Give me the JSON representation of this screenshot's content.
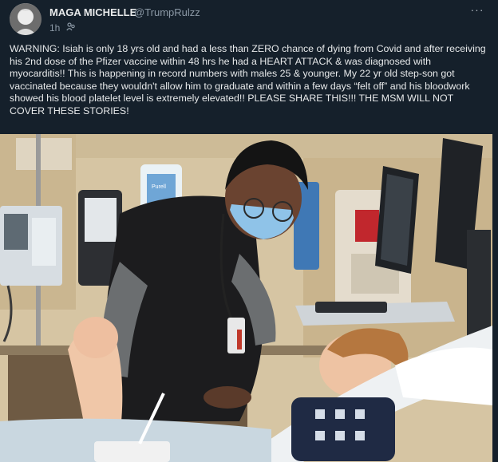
{
  "post": {
    "author_name": "MAGA MICHELLE",
    "author_handle": "@TrumpRulzz",
    "time": "1h",
    "audience_icon": "friends-icon",
    "more_label": "···",
    "text": "WARNING: Isiah is only 18 yrs old and had a less than ZERO chance of dying from Covid and after receiving his 2nd dose of the Pfizer vaccine within 48 hrs he had a HEART ATTACK & was diagnosed with myocarditis!! This is happening in record numbers with males 25 & younger. My 22 yr old step-son got vaccinated because they wouldn't allow him to graduate and within a few days “felt off” and his bloodwork showed his blood platelet level is extremely elevated!! PLEASE SHARE THIS!!! THE MSM WILL NOT COVER THESE STORIES!"
  },
  "photo": {
    "dispenser_brand": "Purell"
  },
  "colors": {
    "background": "#15202b",
    "text": "#e7e9ea",
    "secondary_text": "#8b98a5"
  }
}
